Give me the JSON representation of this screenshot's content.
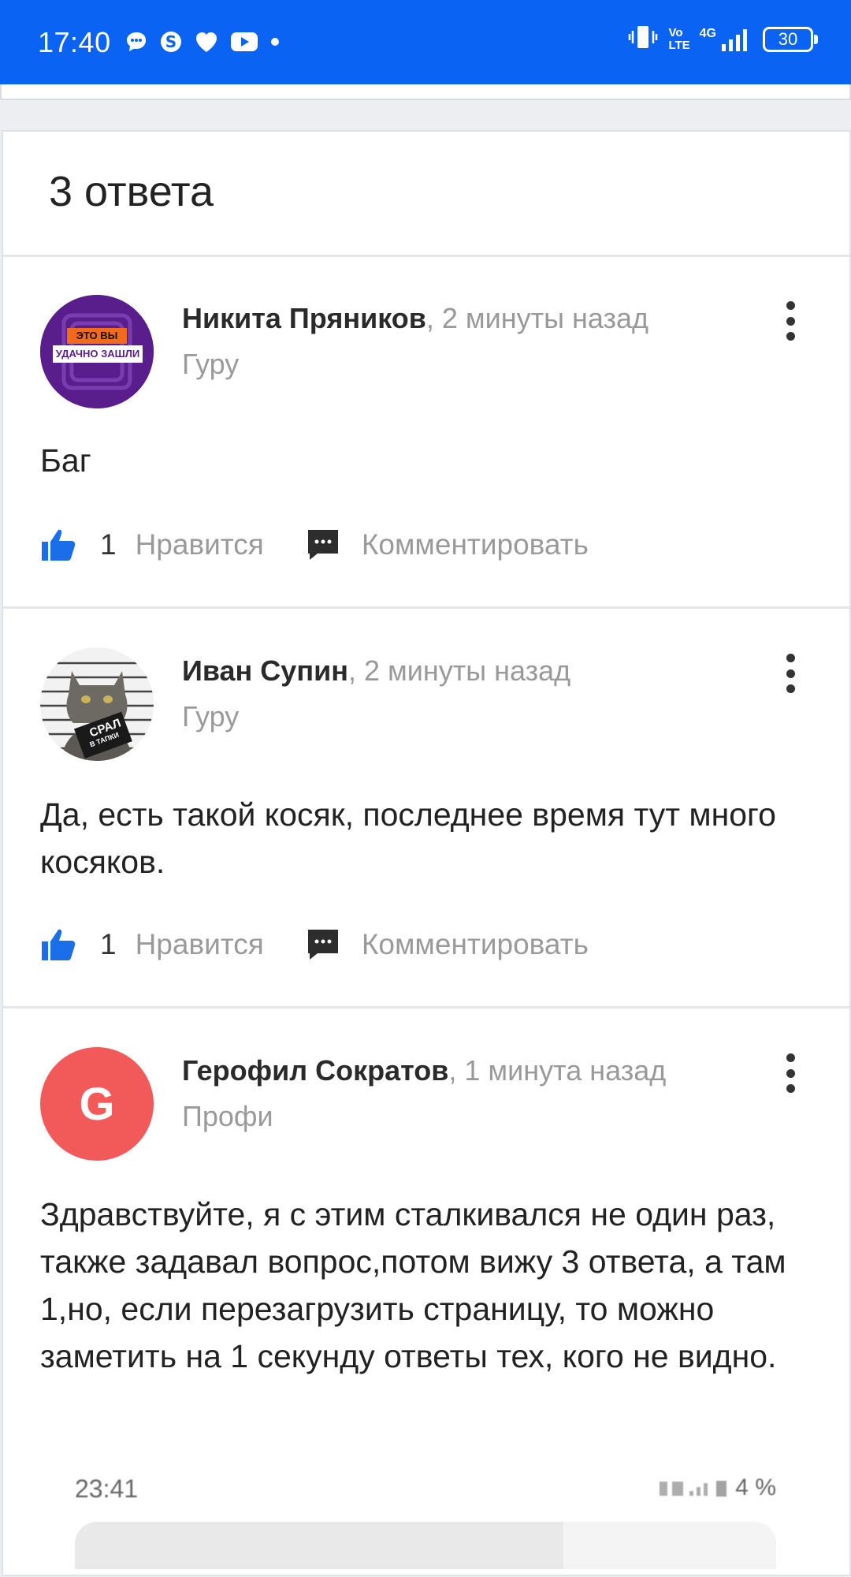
{
  "status_bar": {
    "time": "17:40",
    "notification_icons": [
      "chat-bubble-icon",
      "skype-icon",
      "heart-icon",
      "youtube-icon",
      "dot-icon"
    ],
    "right_icons": [
      "vibrate-icon",
      "volte-icon",
      "4g-signal-icon"
    ],
    "network_top": "Vo",
    "network_bottom": "LTE",
    "net_type": "4G",
    "battery": "30"
  },
  "answers_count_label": "3 ответа",
  "answers": [
    {
      "author": "Никита Пряников",
      "time": ", 2 минуты назад",
      "rank": "Гуру",
      "avatar_text_top": "ЭТО ВЫ",
      "avatar_text_bottom": "УДАЧНО ЗАШЛИ",
      "text": "Баг",
      "likes": "1",
      "like_label": "Нравится",
      "comment_label": "Комментировать"
    },
    {
      "author": "Иван Супин",
      "time": ", 2 минуты назад",
      "rank": "Гуру",
      "avatar_sign_top": "СРАЛ",
      "avatar_sign_bottom": "В ТАПКИ",
      "text": "Да, есть такой косяк, последнее время тут много косяков.",
      "likes": "1",
      "like_label": "Нравится",
      "comment_label": "Комментировать"
    },
    {
      "author": "Герофил Сократов",
      "time": ", 1 минута назад",
      "rank": "Профи",
      "avatar_letter": "G",
      "text": "Здравствуйте, я с этим сталкивался не один раз, также задавал вопрос,потом вижу 3 ответа, а там 1,но, если перезагрузить страницу, то можно заметить на 1 секунду ответы тех, кого не видно."
    }
  ],
  "embedded_screenshot": {
    "time": "23:41",
    "battery": "4 %"
  },
  "colors": {
    "status_bar": "#0a63f2",
    "like_icon": "#1a6fe8",
    "avatar_g": "#f25a5a"
  }
}
